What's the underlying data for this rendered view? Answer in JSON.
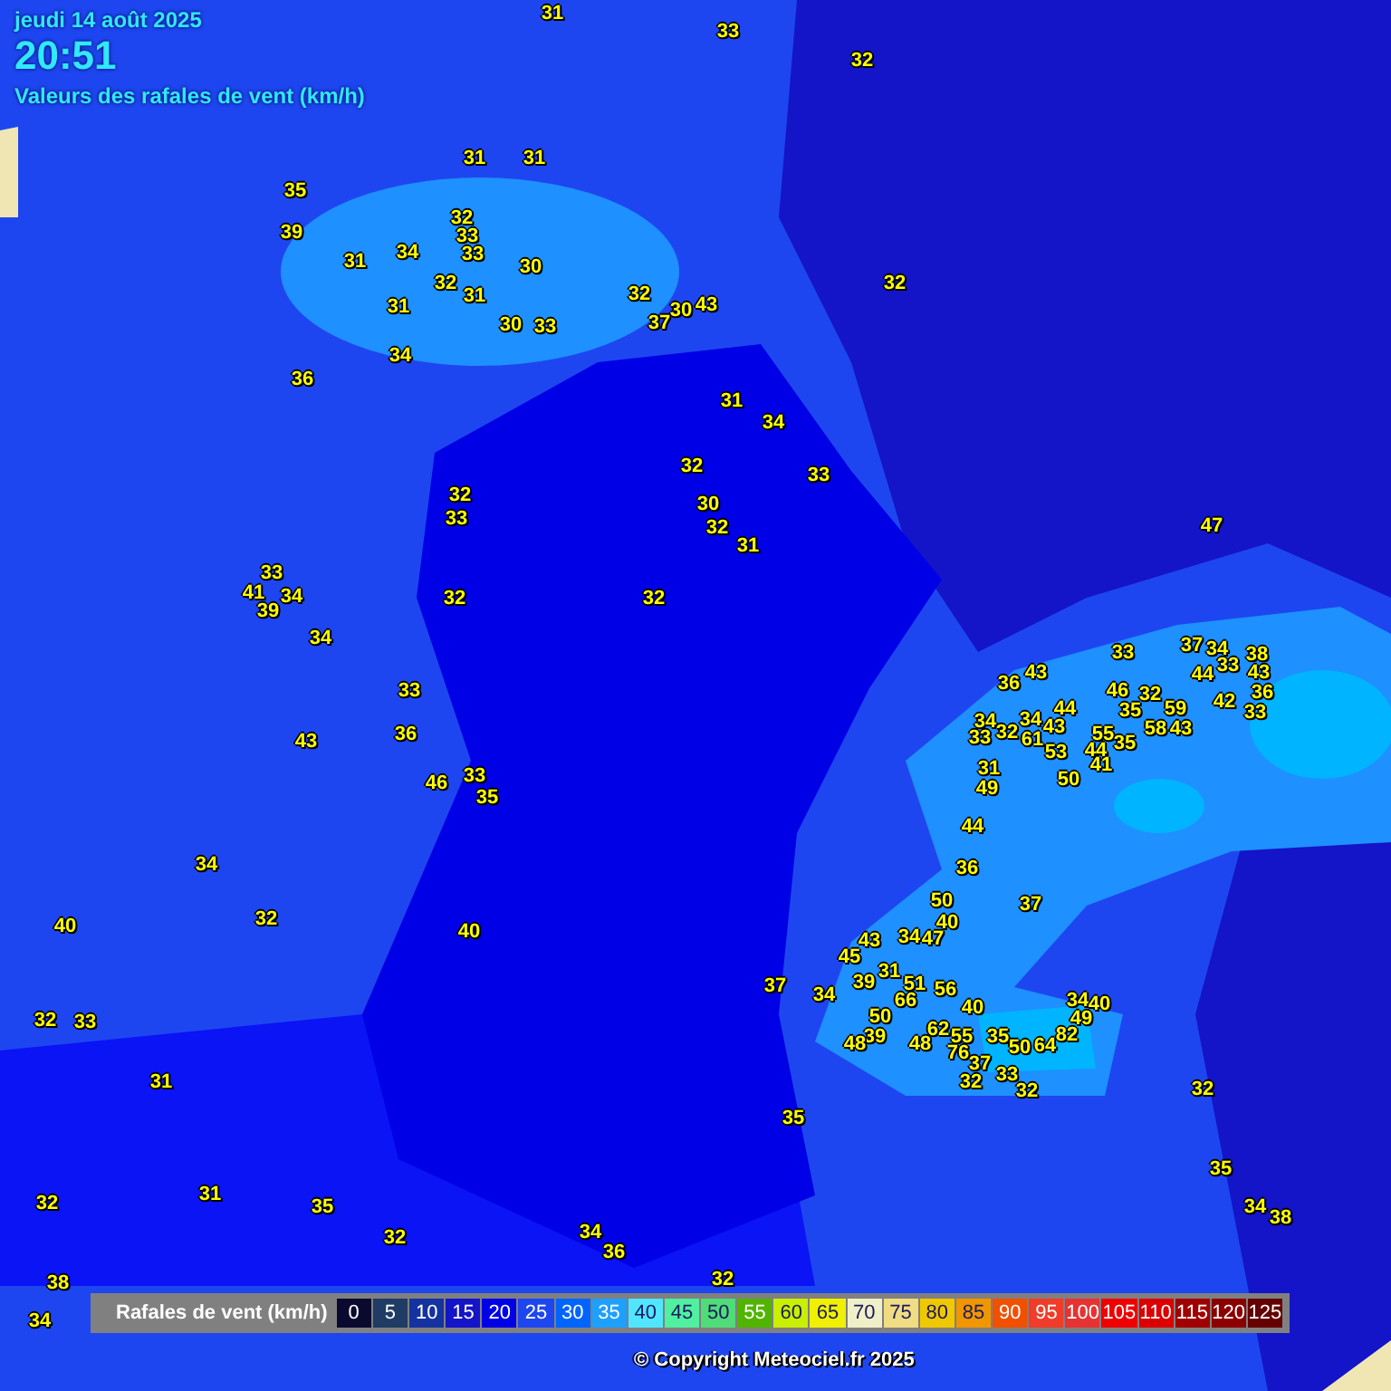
{
  "header": {
    "date": "jeudi 14 août 2025",
    "time": "20:51",
    "subtitle": "Valeurs des rafales de vent (km/h)"
  },
  "stations": [
    {
      "value": "31"
    },
    {
      "value": "33"
    },
    {
      "value": "32"
    },
    {
      "value": "31"
    },
    {
      "value": "31"
    },
    {
      "value": "35"
    },
    {
      "value": "39"
    },
    {
      "value": "32"
    },
    {
      "value": "33"
    },
    {
      "value": "34"
    },
    {
      "value": "33"
    },
    {
      "value": "31"
    },
    {
      "value": "30"
    },
    {
      "value": "32"
    },
    {
      "value": "31"
    },
    {
      "value": "31"
    },
    {
      "value": "30"
    },
    {
      "value": "33"
    },
    {
      "value": "34"
    },
    {
      "value": "36"
    },
    {
      "value": "32"
    },
    {
      "value": "37"
    },
    {
      "value": "30"
    },
    {
      "value": "43"
    },
    {
      "value": "32"
    },
    {
      "value": "31"
    },
    {
      "value": "34"
    },
    {
      "value": "32"
    },
    {
      "value": "33"
    },
    {
      "value": "32"
    },
    {
      "value": "30"
    },
    {
      "value": "33"
    },
    {
      "value": "32"
    },
    {
      "value": "31"
    },
    {
      "value": "47"
    },
    {
      "value": "33"
    },
    {
      "value": "41"
    },
    {
      "value": "34"
    },
    {
      "value": "39"
    },
    {
      "value": "32"
    },
    {
      "value": "32"
    },
    {
      "value": "34"
    },
    {
      "value": "33"
    },
    {
      "value": "43"
    },
    {
      "value": "36"
    },
    {
      "value": "46"
    },
    {
      "value": "33"
    },
    {
      "value": "35"
    },
    {
      "value": "34"
    },
    {
      "value": "32"
    },
    {
      "value": "40"
    },
    {
      "value": "40"
    },
    {
      "value": "32"
    },
    {
      "value": "33"
    },
    {
      "value": "31"
    },
    {
      "value": "32"
    },
    {
      "value": "31"
    },
    {
      "value": "35"
    },
    {
      "value": "32"
    },
    {
      "value": "34"
    },
    {
      "value": "36"
    },
    {
      "value": "32"
    },
    {
      "value": "38"
    },
    {
      "value": "34"
    },
    {
      "value": "33"
    },
    {
      "value": "36"
    },
    {
      "value": "43"
    },
    {
      "value": "37"
    },
    {
      "value": "34"
    },
    {
      "value": "33"
    },
    {
      "value": "44"
    },
    {
      "value": "38"
    },
    {
      "value": "43"
    },
    {
      "value": "42"
    },
    {
      "value": "36"
    },
    {
      "value": "33"
    },
    {
      "value": "46"
    },
    {
      "value": "32"
    },
    {
      "value": "35"
    },
    {
      "value": "59"
    },
    {
      "value": "58"
    },
    {
      "value": "43"
    },
    {
      "value": "44"
    },
    {
      "value": "34"
    },
    {
      "value": "43"
    },
    {
      "value": "61"
    },
    {
      "value": "53"
    },
    {
      "value": "50"
    },
    {
      "value": "55"
    },
    {
      "value": "44"
    },
    {
      "value": "35"
    },
    {
      "value": "41"
    },
    {
      "value": "34"
    },
    {
      "value": "33"
    },
    {
      "value": "32"
    },
    {
      "value": "31"
    },
    {
      "value": "49"
    },
    {
      "value": "44"
    },
    {
      "value": "36"
    },
    {
      "value": "37"
    },
    {
      "value": "50"
    },
    {
      "value": "40"
    },
    {
      "value": "43"
    },
    {
      "value": "45"
    },
    {
      "value": "34"
    },
    {
      "value": "47"
    },
    {
      "value": "37"
    },
    {
      "value": "34"
    },
    {
      "value": "39"
    },
    {
      "value": "31"
    },
    {
      "value": "51"
    },
    {
      "value": "56"
    },
    {
      "value": "66"
    },
    {
      "value": "40"
    },
    {
      "value": "50"
    },
    {
      "value": "39"
    },
    {
      "value": "48"
    },
    {
      "value": "62"
    },
    {
      "value": "55"
    },
    {
      "value": "48"
    },
    {
      "value": "76"
    },
    {
      "value": "37"
    },
    {
      "value": "32"
    },
    {
      "value": "35"
    },
    {
      "value": "50"
    },
    {
      "value": "64"
    },
    {
      "value": "82"
    },
    {
      "value": "49"
    },
    {
      "value": "34"
    },
    {
      "value": "40"
    },
    {
      "value": "33"
    },
    {
      "value": "32"
    },
    {
      "value": "35"
    },
    {
      "value": "32"
    },
    {
      "value": "35"
    },
    {
      "value": "34"
    },
    {
      "value": "38"
    }
  ],
  "legend": {
    "title": "Rafales de vent (km/h)",
    "items": [
      {
        "label": "0",
        "color": "#0a0a30"
      },
      {
        "label": "5",
        "color": "#1e3c64"
      },
      {
        "label": "10",
        "color": "#1432a0"
      },
      {
        "label": "15",
        "color": "#1414c8"
      },
      {
        "label": "20",
        "color": "#0000e6"
      },
      {
        "label": "25",
        "color": "#1e46f0"
      },
      {
        "label": "30",
        "color": "#0064ff"
      },
      {
        "label": "35",
        "color": "#1ea0ff"
      },
      {
        "label": "40",
        "color": "#50e6ff"
      },
      {
        "label": "45",
        "color": "#50f0a0"
      },
      {
        "label": "50",
        "color": "#50dc78"
      },
      {
        "label": "55",
        "color": "#50b400"
      },
      {
        "label": "60",
        "color": "#c8f000"
      },
      {
        "label": "65",
        "color": "#f0f000"
      },
      {
        "label": "70",
        "color": "#f0f0c8"
      },
      {
        "label": "75",
        "color": "#f0dc82"
      },
      {
        "label": "80",
        "color": "#f0c800"
      },
      {
        "label": "85",
        "color": "#f09600"
      },
      {
        "label": "90",
        "color": "#f05000"
      },
      {
        "label": "95",
        "color": "#f03c28"
      },
      {
        "label": "100",
        "color": "#e63232"
      },
      {
        "label": "105",
        "color": "#f00000"
      },
      {
        "label": "110",
        "color": "#dc0000"
      },
      {
        "label": "115",
        "color": "#a00000"
      },
      {
        "label": "120",
        "color": "#8c0000"
      },
      {
        "label": "125",
        "color": "#640000"
      }
    ]
  },
  "copyright": "© Copyright Meteociel.fr 2025"
}
